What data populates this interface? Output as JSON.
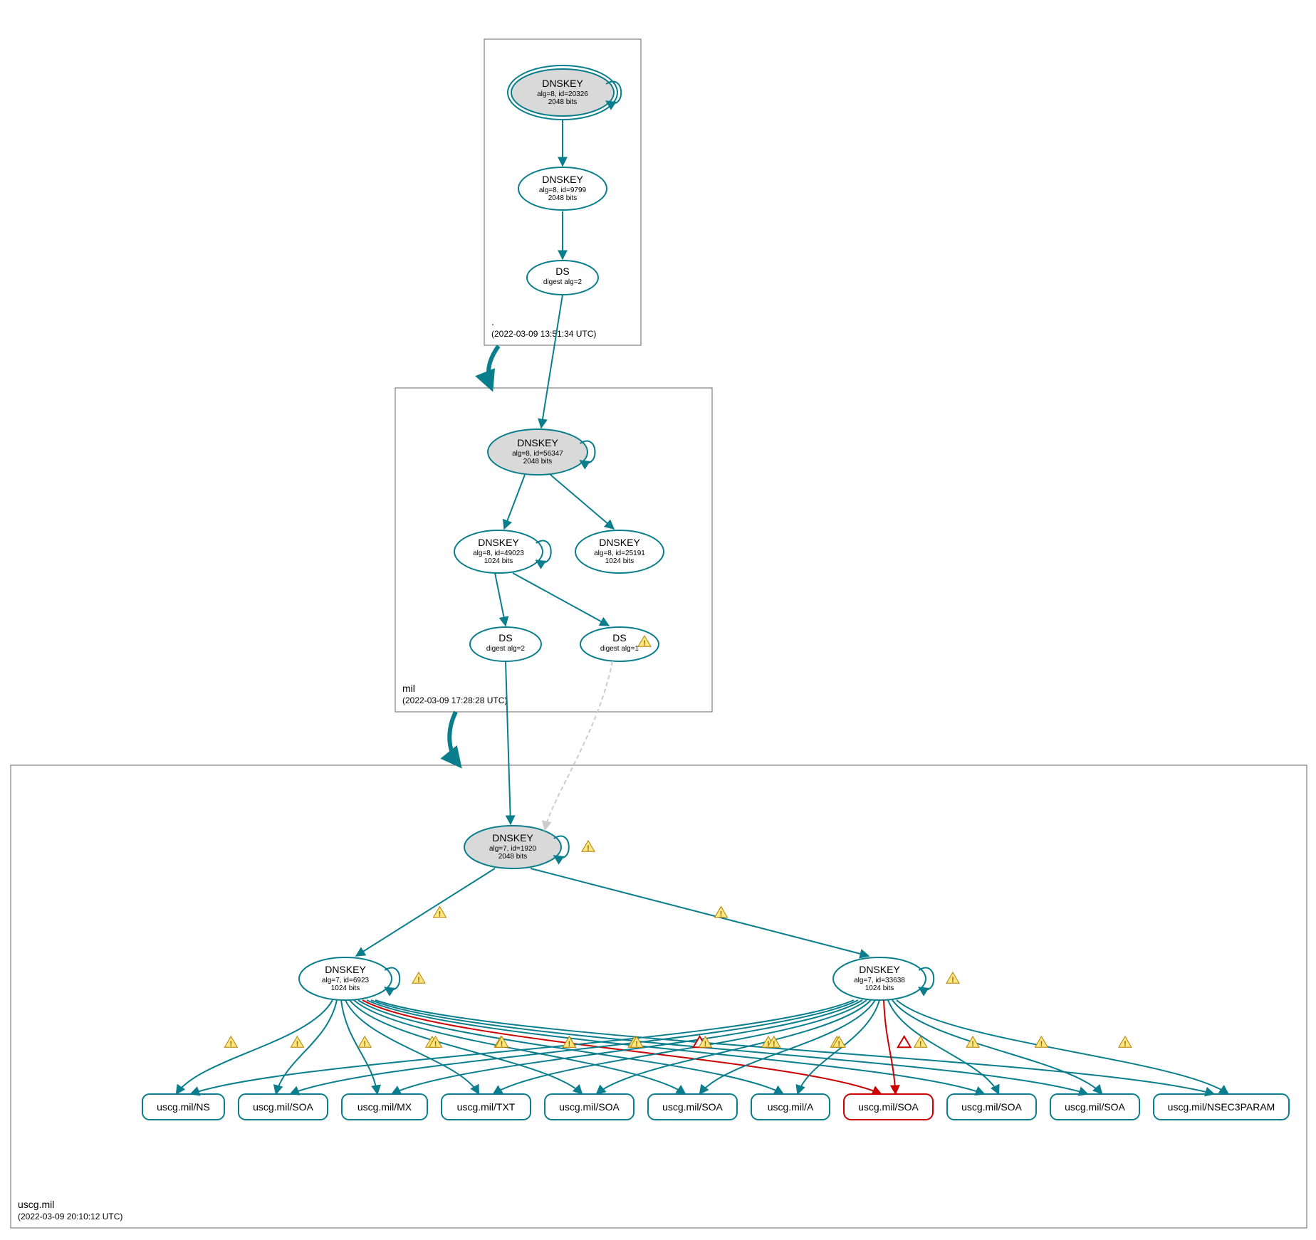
{
  "colors": {
    "teal": "#0a7e8c",
    "gray_fill": "#d9d9d9",
    "red": "#cc0000",
    "dashed_gray": "#cccccc"
  },
  "zones": {
    "root": {
      "label": ".",
      "timestamp": "(2022-03-09 13:51:34 UTC)",
      "nodes": {
        "ksk": {
          "title": "DNSKEY",
          "line1": "alg=8, id=20326",
          "line2": "2048 bits"
        },
        "zsk": {
          "title": "DNSKEY",
          "line1": "alg=8, id=9799",
          "line2": "2048 bits"
        },
        "ds": {
          "title": "DS",
          "line1": "digest alg=2"
        }
      }
    },
    "mil": {
      "label": "mil",
      "timestamp": "(2022-03-09 17:28:28 UTC)",
      "nodes": {
        "ksk": {
          "title": "DNSKEY",
          "line1": "alg=8, id=56347",
          "line2": "2048 bits"
        },
        "zsk1": {
          "title": "DNSKEY",
          "line1": "alg=8, id=49023",
          "line2": "1024 bits"
        },
        "zsk2": {
          "title": "DNSKEY",
          "line1": "alg=8, id=25191",
          "line2": "1024 bits"
        },
        "ds1": {
          "title": "DS",
          "line1": "digest alg=2"
        },
        "ds2": {
          "title": "DS",
          "line1": "digest alg=1"
        }
      }
    },
    "uscg": {
      "label": "uscg.mil",
      "timestamp": "(2022-03-09 20:10:12 UTC)",
      "nodes": {
        "ksk": {
          "title": "DNSKEY",
          "line1": "alg=7, id=1920",
          "line2": "2048 bits"
        },
        "zsk1": {
          "title": "DNSKEY",
          "line1": "alg=7, id=6923",
          "line2": "1024 bits"
        },
        "zsk2": {
          "title": "DNSKEY",
          "line1": "alg=7, id=33638",
          "line2": "1024 bits"
        }
      },
      "rrsets": [
        "uscg.mil/NS",
        "uscg.mil/SOA",
        "uscg.mil/MX",
        "uscg.mil/TXT",
        "uscg.mil/SOA",
        "uscg.mil/SOA",
        "uscg.mil/A",
        "uscg.mil/SOA",
        "uscg.mil/SOA",
        "uscg.mil/SOA",
        "uscg.mil/NSEC3PARAM"
      ],
      "error_rrset_index": 7
    }
  }
}
